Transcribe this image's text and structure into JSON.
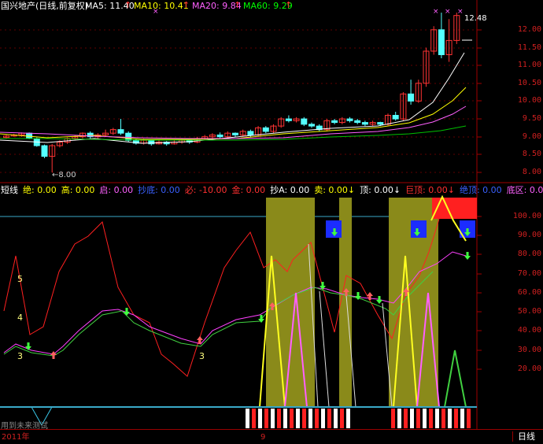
{
  "header": {
    "stock_name": "国兴地产(日线,前复权)",
    "ma5": "MA5: 11.40",
    "ma10": "MA10: 10.41",
    "ma20": "MA20: 9.84",
    "ma60": "MA60: 9.29",
    "up_arrow": "↑"
  },
  "indicator_header": [
    {
      "label": "短线",
      "color": "#ffffff"
    },
    {
      "label": "绝: 0.00",
      "color": "#ffff00"
    },
    {
      "label": "高: 0.00",
      "color": "#ffff00"
    },
    {
      "label": "启: 0.00",
      "color": "#ff60ff"
    },
    {
      "label": "抄底: 0.00",
      "color": "#3a60ff"
    },
    {
      "label": "必: -10.00",
      "color": "#ff3030"
    },
    {
      "label": "金: 0.00",
      "color": "#ff3030"
    },
    {
      "label": "抄A: 0.00",
      "color": "#ffffff"
    },
    {
      "label": "卖: 0.00↓",
      "color": "#ffff00"
    },
    {
      "label": "顶: 0.00↓",
      "color": "#ffffff"
    },
    {
      "label": "巨顶: 0.00↓",
      "color": "#ff3030"
    },
    {
      "label": "绝顶: 0.00",
      "color": "#3a60ff"
    },
    {
      "label": "底区: 0.00",
      "color": "#ff60ff"
    }
  ],
  "price_axis": [
    "12.00",
    "11.50",
    "11.00",
    "10.50",
    "10.00",
    "9.50",
    "9.00",
    "8.50",
    "8.00"
  ],
  "indicator_axis": [
    "100.00",
    "90.00",
    "80.00",
    "70.00",
    "60.00",
    "50.00",
    "40.00",
    "30.00",
    "20.00"
  ],
  "annotations": {
    "high_price": "12.48",
    "low_price": "←8.00",
    "level_5": "5",
    "level_4": "4",
    "level_3a": "3",
    "level_3b": "3",
    "future_test": "用到未来测试"
  },
  "bottom_bar": {
    "year": "2011年",
    "month": "9",
    "period": "日线"
  },
  "colors": {
    "up": "#ff3333",
    "down": "#54ffff",
    "ma5": "#ffffff",
    "ma10": "#ffff00",
    "ma20": "#ff60ff",
    "ma60": "#00c000",
    "olive": "#8a8a1a"
  }
}
